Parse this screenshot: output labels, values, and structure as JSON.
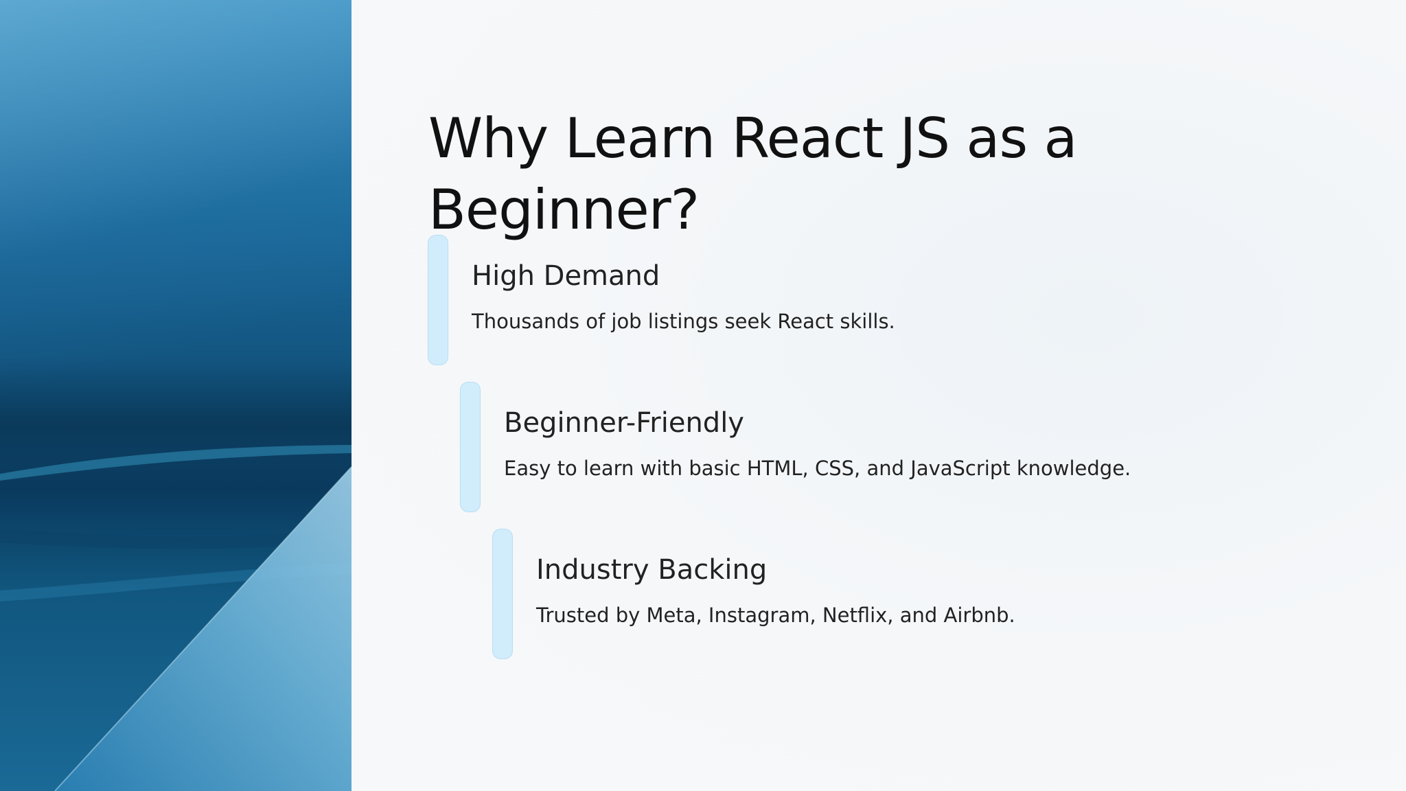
{
  "slide": {
    "title": "Why Learn React JS as a Beginner?",
    "items": [
      {
        "heading": "High Demand",
        "description": "Thousands of job listings seek React skills."
      },
      {
        "heading": "Beginner-Friendly",
        "description": "Easy to learn with basic HTML, CSS, and JavaScript knowledge."
      },
      {
        "heading": "Industry Backing",
        "description": "Trusted by Meta, Instagram, Netflix, and Airbnb."
      }
    ]
  },
  "colors": {
    "accent_bar": "#d1ecfb",
    "panel_blue": "#1c6a9c",
    "text": "#222222"
  }
}
